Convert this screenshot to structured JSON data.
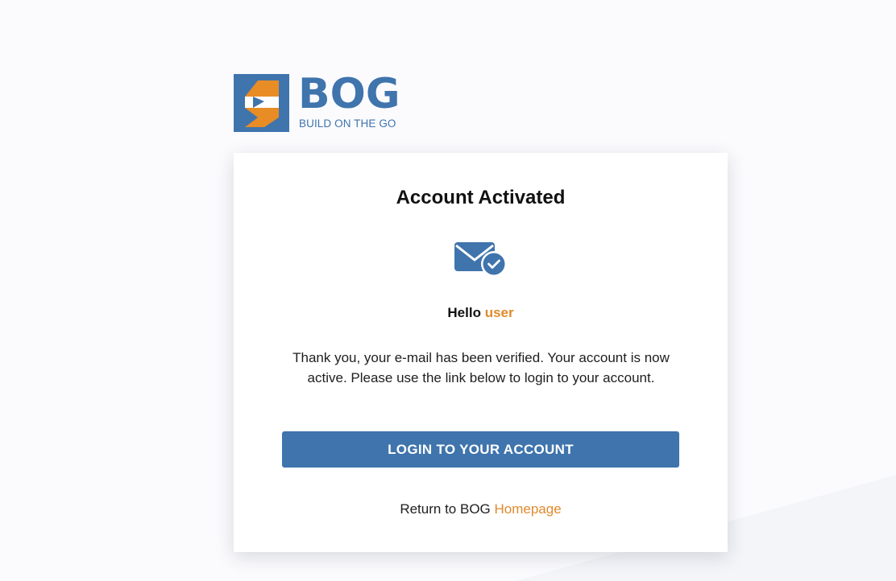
{
  "brand": {
    "name": "BOG",
    "tagline": "BUILD ON THE GO",
    "primary_color": "#3f74ad",
    "accent_color": "#e08a2c",
    "logo_icon": "bog-logo-mark"
  },
  "card": {
    "title": "Account Activated",
    "icon": "mail-check-icon",
    "greeting_prefix": "Hello",
    "username": "user",
    "message": "Thank you, your e-mail has been verified. Your account is now active. Please use the link below to login to your account.",
    "login_button_label": "LOGIN TO YOUR ACCOUNT",
    "return_prefix": "Return to BOG",
    "return_link_label": "Homepage"
  }
}
